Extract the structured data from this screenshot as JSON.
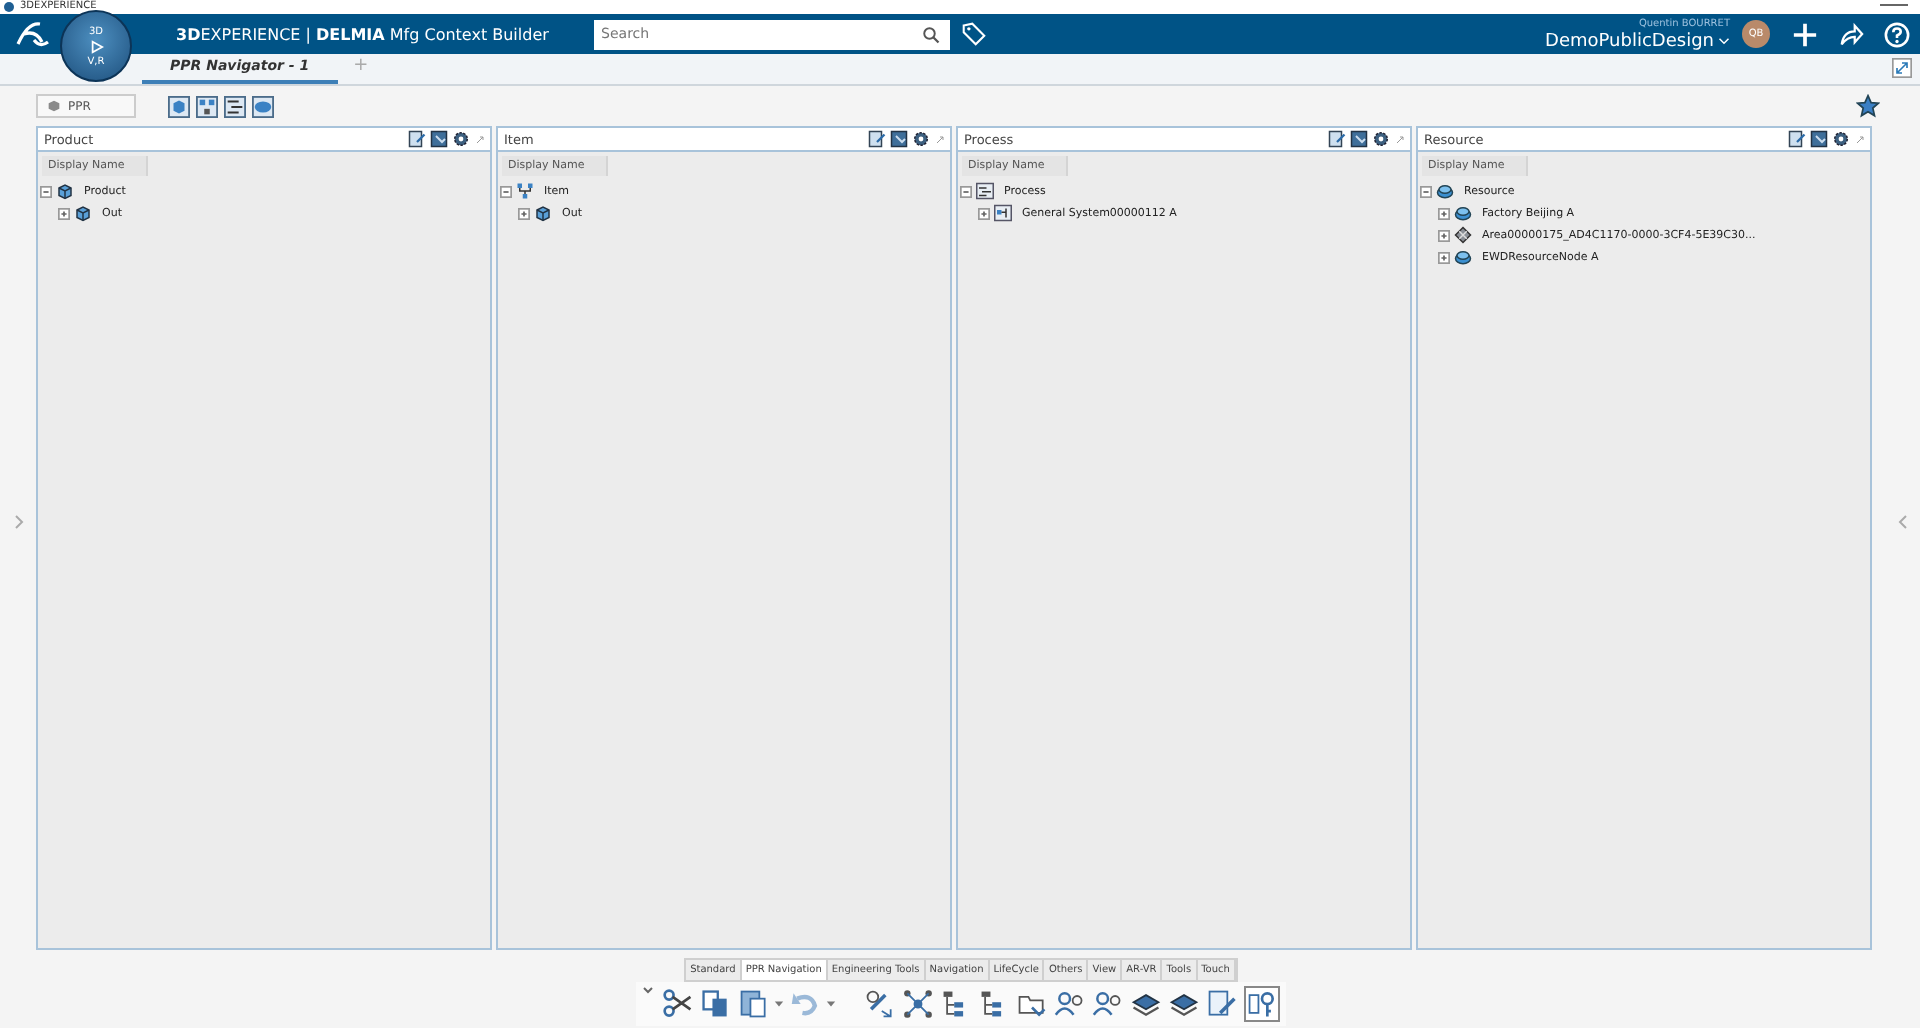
{
  "window": {
    "title": "3DEXPERIENCE"
  },
  "top_bar": {
    "brand_bold": "3D",
    "brand_rest": "EXPERIENCE | ",
    "app_bold": "DELMIA",
    "app_rest": " Mfg Context Builder",
    "compass_top": "3D",
    "compass_bottom": "V,R",
    "search": {
      "placeholder": "Search"
    },
    "user_name": "Quentin BOURRET",
    "collab_space": "DemoPublicDesign",
    "avatar_initials": "QB"
  },
  "tabs": [
    {
      "label": "PPR Navigator - 1",
      "selected": true
    },
    {
      "label": "+",
      "selected": false
    }
  ],
  "ppr_button": {
    "label": "PPR"
  },
  "panels": [
    {
      "title": "Product",
      "column": "Display Name",
      "tree": [
        {
          "label": "Product",
          "kind": "product",
          "expanded": true,
          "children": [
            {
              "label": "Out",
              "kind": "product",
              "expanded": false
            }
          ]
        }
      ]
    },
    {
      "title": "Item",
      "column": "Display Name",
      "tree": [
        {
          "label": "Item",
          "kind": "item",
          "expanded": true,
          "children": [
            {
              "label": "Out",
              "kind": "product",
              "expanded": false
            }
          ]
        }
      ]
    },
    {
      "title": "Process",
      "column": "Display Name",
      "tree": [
        {
          "label": "Process",
          "kind": "process",
          "expanded": true,
          "children": [
            {
              "label": "General System00000112 A",
              "kind": "system",
              "expanded": false
            }
          ]
        }
      ]
    },
    {
      "title": "Resource",
      "column": "Display Name",
      "tree": [
        {
          "label": "Resource",
          "kind": "resource",
          "expanded": true,
          "children": [
            {
              "label": "Factory Beijing A",
              "kind": "resource",
              "expanded": false
            },
            {
              "label": "Area00000175_AD4C1170-0000-3CF4-5E39C30...",
              "kind": "area",
              "expanded": false
            },
            {
              "label": "EWDResourceNode A",
              "kind": "resource",
              "expanded": false
            }
          ]
        }
      ]
    }
  ],
  "action_bar": {
    "tabs": [
      {
        "label": "Standard",
        "selected": false
      },
      {
        "label": "PPR Navigation",
        "selected": true
      },
      {
        "label": "Engineering Tools",
        "selected": false
      },
      {
        "label": "Navigation",
        "selected": false
      },
      {
        "label": "LifeCycle",
        "selected": false
      },
      {
        "label": "Others",
        "selected": false
      },
      {
        "label": "View",
        "selected": false
      },
      {
        "label": "AR-VR",
        "selected": false
      },
      {
        "label": "Tools",
        "selected": false
      },
      {
        "label": "Touch",
        "selected": false
      }
    ],
    "commands": [
      {
        "kind": "scissors",
        "selected": false
      },
      {
        "kind": "copy",
        "selected": false
      },
      {
        "kind": "paste",
        "selected": false
      },
      {
        "kind": "undo",
        "selected": false
      },
      {
        "kind": "link",
        "selected": false
      },
      {
        "kind": "network",
        "selected": false
      },
      {
        "kind": "tree",
        "selected": false
      },
      {
        "kind": "tree",
        "selected": false
      },
      {
        "kind": "folder",
        "selected": false
      },
      {
        "kind": "people",
        "selected": false
      },
      {
        "kind": "people",
        "selected": false
      },
      {
        "kind": "parts",
        "selected": false
      },
      {
        "kind": "parts",
        "selected": false
      },
      {
        "kind": "document",
        "selected": false
      },
      {
        "kind": "key",
        "selected": true
      }
    ]
  }
}
